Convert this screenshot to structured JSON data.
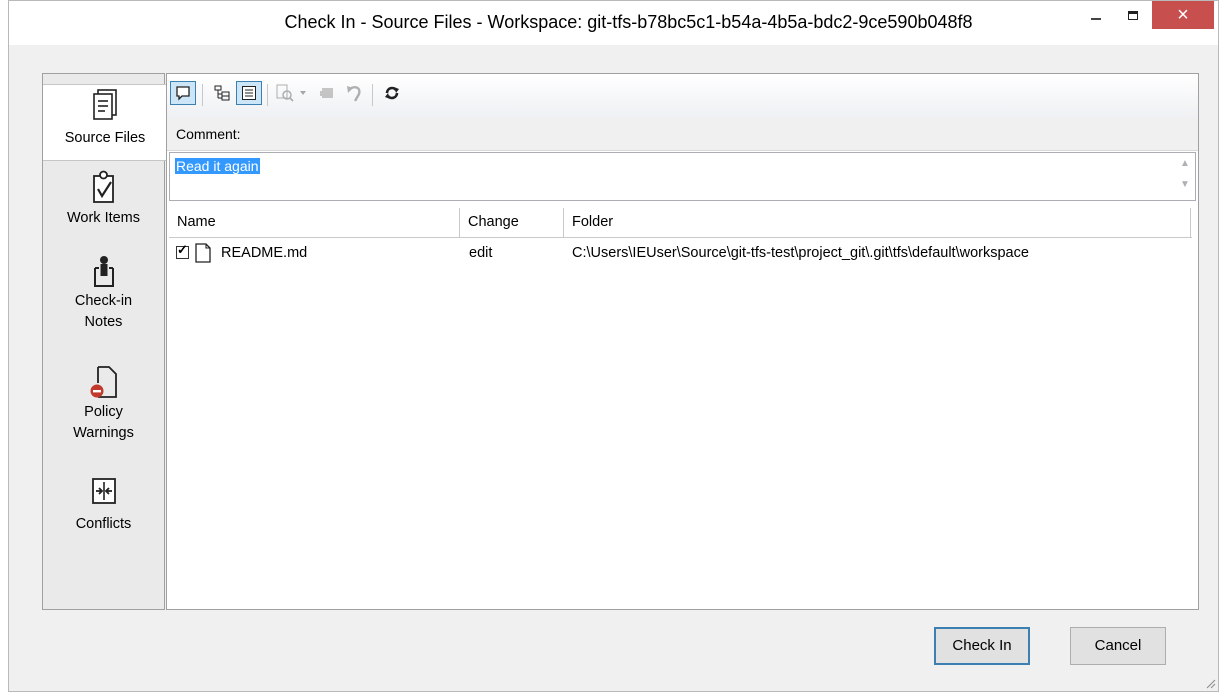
{
  "window": {
    "title": "Check In - Source Files - Workspace: git-tfs-b78bc5c1-b54a-4b5a-bdc2-9ce590b048f8",
    "close_glyph": "×"
  },
  "sidebar": {
    "items": [
      {
        "label": "Source Files",
        "icon": "source-files-icon",
        "active": true
      },
      {
        "label": "Work Items",
        "icon": "work-items-icon",
        "active": false
      },
      {
        "label_line1": "Check-in",
        "label_line2": "Notes",
        "icon": "check-in-notes-icon",
        "active": false
      },
      {
        "label_line1": "Policy",
        "label_line2": "Warnings",
        "icon": "policy-warnings-icon",
        "active": false
      },
      {
        "label": "Conflicts",
        "icon": "conflicts-icon",
        "active": false
      }
    ]
  },
  "toolbar": {
    "buttons": [
      "comment-icon",
      "tree-view-icon",
      "flat-view-icon",
      "compare-icon",
      "dropdown-arrow-icon",
      "shelve-icon",
      "undo-icon",
      "refresh-icon"
    ]
  },
  "comment": {
    "label": "Comment:",
    "value": "Read it again"
  },
  "filelist": {
    "columns": [
      "Name",
      "Change",
      "Folder"
    ],
    "rows": [
      {
        "checked": true,
        "name": "README.md",
        "change": "edit",
        "folder": "C:\\Users\\IEUser\\Source\\git-tfs-test\\project_git\\.git\\tfs\\default\\workspace"
      }
    ]
  },
  "buttons": {
    "check_in": "Check In",
    "cancel": "Cancel"
  },
  "colors": {
    "accent": "#3c7fb1",
    "selection": "#3399ff",
    "close": "#c7504f"
  }
}
